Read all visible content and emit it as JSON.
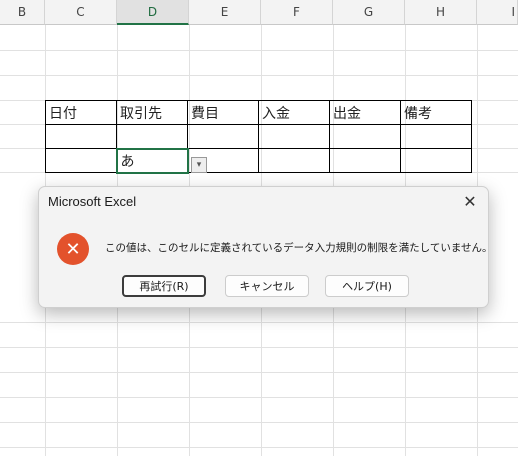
{
  "columns": [
    "B",
    "C",
    "D",
    "E",
    "F",
    "G",
    "H",
    "I"
  ],
  "selected_column": "D",
  "table": {
    "headers": [
      "日付",
      "取引先",
      "費目",
      "入金",
      "出金",
      "備考"
    ],
    "input_value": "あ",
    "dropdown_glyph": "▾"
  },
  "dialog": {
    "title": "Microsoft Excel",
    "close_glyph": "✕",
    "error_glyph": "✕",
    "message": "この値は、このセルに定義されているデータ入力規則の制限を満たしていません。",
    "buttons": {
      "retry": "再試行(R)",
      "cancel": "キャンセル",
      "help": "ヘルプ(H)"
    }
  },
  "colors": {
    "accent": "#217346",
    "error": "#e3522c"
  }
}
